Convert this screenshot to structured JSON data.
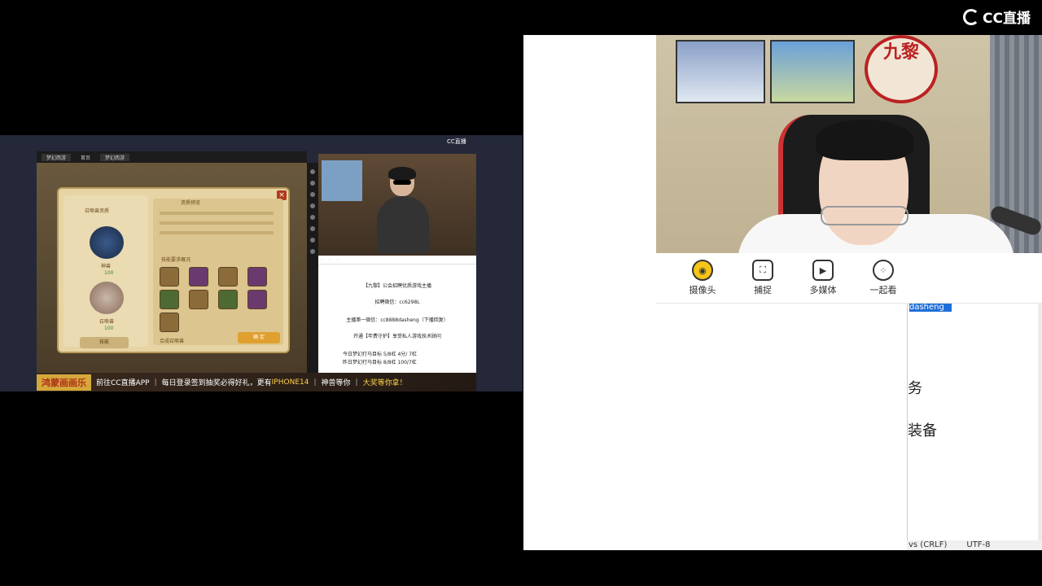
{
  "watermark": {
    "text": "CC直播"
  },
  "left_stream": {
    "game_title": "梦幻西游",
    "game_tabs": [
      "梦幻西游",
      "首页",
      "梦幻西游"
    ],
    "dialog": {
      "left_title": "召唤兽资质",
      "tab": "技能",
      "stats_title": "资质预览",
      "skills_title": "技能要求概况",
      "pet_a_label": "神兽",
      "pet_a_value": "100",
      "pet_b_label": "召唤兽",
      "pet_b_value": "100",
      "footer_text": "合成召唤兽",
      "confirm_label": "确 定",
      "close_label": "×"
    },
    "inset_logo": "CC直播",
    "inset_text": {
      "line1": "【九黎】公会招聘优质游戏主播",
      "line2": "招聘微信：cc6298L",
      "line3": "主播第一微信：cc8888dasheng（下播回复）",
      "line4": "开通【年费守护】享受私人游戏技术顾问",
      "line5": "今日梦幻打马目标 5/8杠 4分/ 7杠",
      "line6": "昨日梦幻打马目标 8/8杠 100/7杠"
    },
    "banner": {
      "badge": "鸿蒙画画乐",
      "part1": "前往CC直播APP",
      "part2": "每日登录签到抽奖必得好礼，更有",
      "highlight": "IPHONE14",
      "part3": "神兽等你",
      "part4": "大奖等你拿！"
    }
  },
  "right_pane": {
    "drum_text": "九黎",
    "toolbar": [
      {
        "label": "摄像头",
        "icon": "camera-icon"
      },
      {
        "label": "捕捉",
        "icon": "capture-icon"
      },
      {
        "label": "多媒体",
        "icon": "multimedia-icon"
      },
      {
        "label": "一起看",
        "icon": "watch-together-icon"
      }
    ],
    "editor": {
      "selected": "dasheng",
      "line_a": "务",
      "line_b": "装备",
      "status_eol": "vs (CRLF)",
      "status_enc": "UTF-8"
    }
  }
}
